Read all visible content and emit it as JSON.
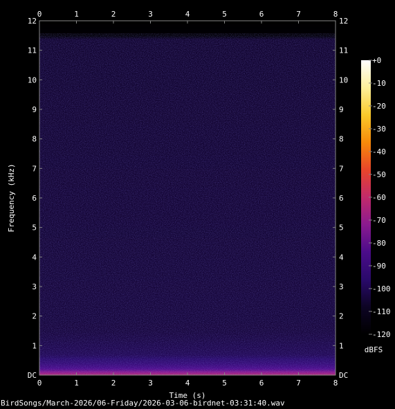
{
  "chart_data": {
    "type": "heatmap",
    "title": "",
    "xlabel": "Time (s)",
    "ylabel": "Frequency (kHz)",
    "xlim": [
      0,
      8
    ],
    "ylim": [
      0,
      12
    ],
    "x_ticks": [
      0,
      1,
      2,
      3,
      4,
      5,
      6,
      7,
      8
    ],
    "x_tick_labels": [
      "0",
      "1",
      "2",
      "3",
      "4",
      "5",
      "6",
      "7",
      "8"
    ],
    "y_ticks": [
      0,
      1,
      2,
      3,
      4,
      5,
      6,
      7,
      8,
      9,
      10,
      11,
      12
    ],
    "y_tick_labels": [
      "DC",
      "1",
      "2",
      "3",
      "4",
      "5",
      "6",
      "7",
      "8",
      "9",
      "10",
      "11",
      "12"
    ],
    "colorbar": {
      "label": "dBFS",
      "range": [
        -120,
        0
      ],
      "ticks": [
        0,
        -10,
        -20,
        -30,
        -40,
        -50,
        -60,
        -70,
        -80,
        -90,
        -100,
        -110,
        -120
      ],
      "tick_labels": [
        "+0",
        "-10",
        "-20",
        "-30",
        "-40",
        "-50",
        "-60",
        "-70",
        "-80",
        "-90",
        "-100",
        "-110",
        "-120"
      ],
      "colormap": [
        "#000000",
        "#0d0424",
        "#2a0a6b",
        "#4b0c8a",
        "#8a1a8f",
        "#c22a6a",
        "#e8452a",
        "#f78a0a",
        "#fbc92a",
        "#fdf09a",
        "#ffffff"
      ]
    },
    "levels_by_frequency": [
      {
        "freq_khz": 0.0,
        "dbfs": -62
      },
      {
        "freq_khz": 0.1,
        "dbfs": -70
      },
      {
        "freq_khz": 0.2,
        "dbfs": -82
      },
      {
        "freq_khz": 0.4,
        "dbfs": -92
      },
      {
        "freq_khz": 0.7,
        "dbfs": -100
      },
      {
        "freq_khz": 1.5,
        "dbfs": -104
      },
      {
        "freq_khz": 5.0,
        "dbfs": -105
      },
      {
        "freq_khz": 11.4,
        "dbfs": -106
      },
      {
        "freq_khz": 11.5,
        "dbfs": -118
      },
      {
        "freq_khz": 12.0,
        "dbfs": -120
      }
    ]
  },
  "caption": "BirdSongs/March-2026/06-Friday/2026-03-06-birdnet-03:31:40.wav"
}
